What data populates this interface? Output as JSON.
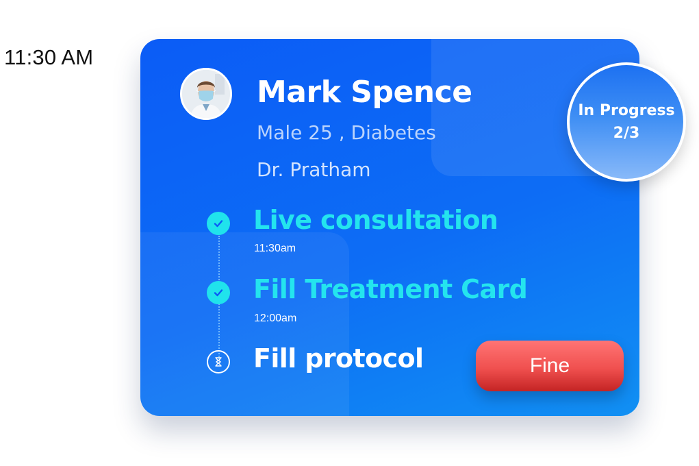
{
  "time_label": "11:30 AM",
  "card": {
    "patient": {
      "name": "Mark Spence",
      "meta": "Male 25 , Diabetes",
      "doctor": "Dr. Pratham"
    },
    "status": {
      "line1": "In Progress",
      "line2": "2/3"
    },
    "steps": [
      {
        "title": "Live consultation",
        "time": "11:30am",
        "state": "done",
        "icon": "check-circle-icon"
      },
      {
        "title": "Fill Treatment Card",
        "time": "12:00am",
        "state": "done",
        "icon": "check-circle-icon"
      },
      {
        "title": "Fill protocol",
        "time": "",
        "state": "pending",
        "icon": "hourglass-icon"
      }
    ],
    "action_button": "Fine"
  },
  "colors": {
    "card_blue": "#0b5cf6",
    "done_cyan": "#24e4ee",
    "button_red": "#f0504f"
  }
}
